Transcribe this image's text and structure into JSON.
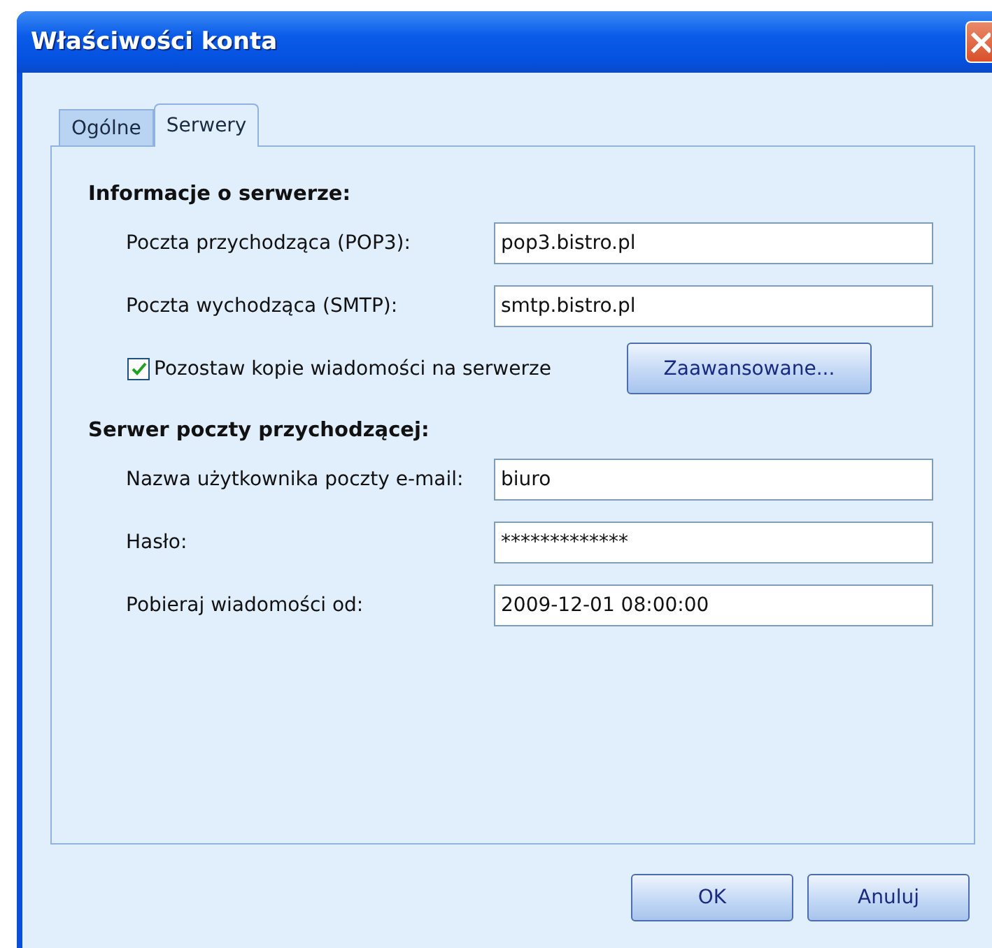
{
  "window": {
    "title": "Właściwości konta"
  },
  "tabs": [
    {
      "label": "Ogólne",
      "selected": false
    },
    {
      "label": "Serwery",
      "selected": true
    }
  ],
  "server_info": {
    "heading": "Informacje o serwerze:",
    "fields": [
      {
        "label": "Poczta przychodząca (POP3):",
        "value": "pop3.bistro.pl"
      },
      {
        "label": "Poczta wychodząca (SMTP):",
        "value": "smtp.bistro.pl"
      }
    ],
    "leave_copies": {
      "label": "Pozostaw kopie wiadomości na serwerze",
      "checked": true
    },
    "advanced_button": "Zaawansowane..."
  },
  "incoming_server": {
    "heading": "Serwer poczty przychodzącej:",
    "fields": [
      {
        "label": "Nazwa użytkownika poczty e-mail:",
        "value": "biuro"
      },
      {
        "label": "Hasło:",
        "value": "*************"
      },
      {
        "label": "Pobieraj wiadomości od:",
        "value": "2009-12-01 08:00:00"
      }
    ]
  },
  "buttons": [
    "OK",
    "Anuluj"
  ]
}
